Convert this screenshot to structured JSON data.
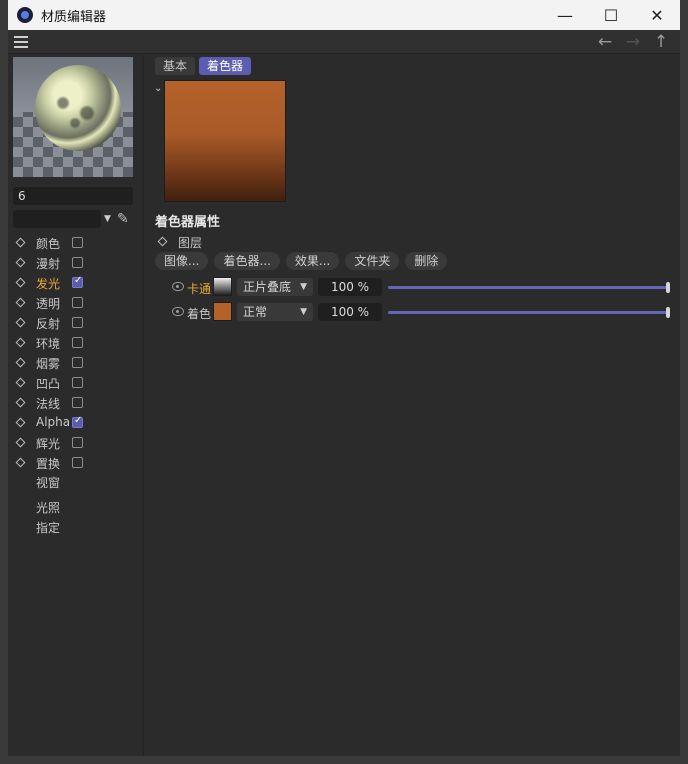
{
  "window": {
    "title": "材质编辑器"
  },
  "window_controls": [
    "—",
    "☐",
    "✕"
  ],
  "nav": [
    "←",
    "→",
    "↑"
  ],
  "left": {
    "material_name": "6",
    "channels": [
      {
        "label": "颜色",
        "checked": false,
        "active": false
      },
      {
        "label": "漫射",
        "checked": false,
        "active": false
      },
      {
        "label": "发光",
        "checked": true,
        "active": true
      },
      {
        "label": "透明",
        "checked": false,
        "active": false
      },
      {
        "label": "反射",
        "checked": false,
        "active": false
      },
      {
        "label": "环境",
        "checked": false,
        "active": false
      },
      {
        "label": "烟雾",
        "checked": false,
        "active": false
      },
      {
        "label": "凹凸",
        "checked": false,
        "active": false
      },
      {
        "label": "法线",
        "checked": false,
        "active": false
      },
      {
        "label": "Alpha",
        "checked": true,
        "active": false
      },
      {
        "label": "辉光",
        "checked": false,
        "active": false
      },
      {
        "label": "置换",
        "checked": false,
        "active": false
      }
    ],
    "extra_items": [
      "视窗",
      "光照",
      "指定"
    ]
  },
  "right": {
    "tabs": [
      {
        "label": "基本",
        "active": false
      },
      {
        "label": "着色器",
        "active": true
      }
    ],
    "section_title": "着色器属性",
    "layer_group_label": "图层",
    "buttons": [
      "图像...",
      "着色器...",
      "效果...",
      "文件夹",
      "删除"
    ],
    "layers": [
      {
        "name": "卡通",
        "active": true,
        "blend_mode": "正片叠底",
        "opacity": "100 %",
        "opacity_value": 100
      },
      {
        "name": "着色",
        "active": false,
        "blend_mode": "正常",
        "opacity": "100 %",
        "opacity_value": 100
      }
    ]
  },
  "colors": {
    "accent": "#5c5cb0",
    "active_text": "#e8a838",
    "shader_color": "#b5622a"
  }
}
